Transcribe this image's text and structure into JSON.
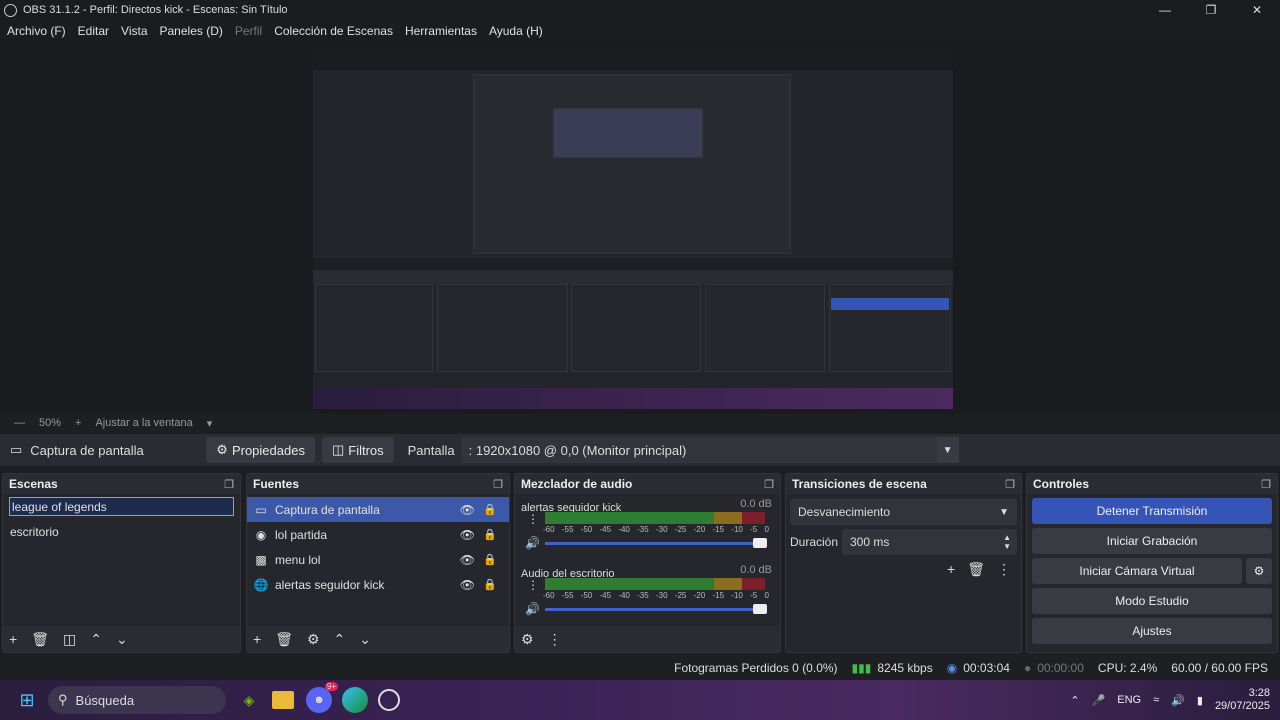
{
  "window": {
    "title": "OBS 31.1.2 - Perfil: Directos kick - Escenas: Sin Título"
  },
  "menu": [
    "Archivo (F)",
    "Editar",
    "Vista",
    "Paneles (D)",
    "Perfil",
    "Colección de Escenas",
    "Herramientas",
    "Ayuda (H)"
  ],
  "menu_disabled": "Perfil",
  "zoom": {
    "level": "50%",
    "fit": "Ajustar a la ventana"
  },
  "source_toolbar": {
    "source": "Captura de pantalla",
    "properties": "Propiedades",
    "filters": "Filtros",
    "display_label": "Pantalla",
    "display_value": ": 1920x1080 @ 0,0 (Monitor principal)"
  },
  "scenes": {
    "title": "Escenas",
    "items": [
      "league of legends",
      "escritorio"
    ]
  },
  "sources": {
    "title": "Fuentes",
    "items": [
      {
        "name": "Captura de pantalla",
        "icon": "monitor-icon"
      },
      {
        "name": "lol partida",
        "icon": "gamepad-icon"
      },
      {
        "name": "menu lol",
        "icon": "window-icon"
      },
      {
        "name": "alertas seguidor kick",
        "icon": "globe-icon"
      }
    ]
  },
  "mixer": {
    "title": "Mezclador de audio",
    "channels": [
      {
        "name": "alertas seguidor kick",
        "db": "0.0 dB"
      },
      {
        "name": "Audio del escritorio",
        "db": "0.0 dB"
      }
    ],
    "ticks": [
      "-60",
      "-55",
      "-50",
      "-45",
      "-40",
      "-35",
      "-30",
      "-25",
      "-20",
      "-15",
      "-10",
      "-5",
      "0"
    ]
  },
  "transitions": {
    "title": "Transiciones de escena",
    "type": "Desvanecimiento",
    "duration_label": "Duración",
    "duration_value": "300 ms"
  },
  "controls": {
    "title": "Controles",
    "buttons": [
      "Detener Transmisión",
      "Iniciar Grabación",
      "Iniciar Cámara Virtual",
      "Modo Estudio",
      "Ajustes"
    ]
  },
  "status": {
    "dropped": "Fotogramas Perdidos 0 (0.0%)",
    "bitrate": "8245 kbps",
    "stream_time": "00:03:04",
    "rec_time": "00:00:00",
    "cpu": "CPU: 2.4%",
    "fps": "60.00 / 60.00 FPS"
  },
  "taskbar": {
    "search": "Búsqueda",
    "lang": "ENG",
    "time": "3:28",
    "date": "29/07/2025",
    "discord_badge": "9+"
  }
}
